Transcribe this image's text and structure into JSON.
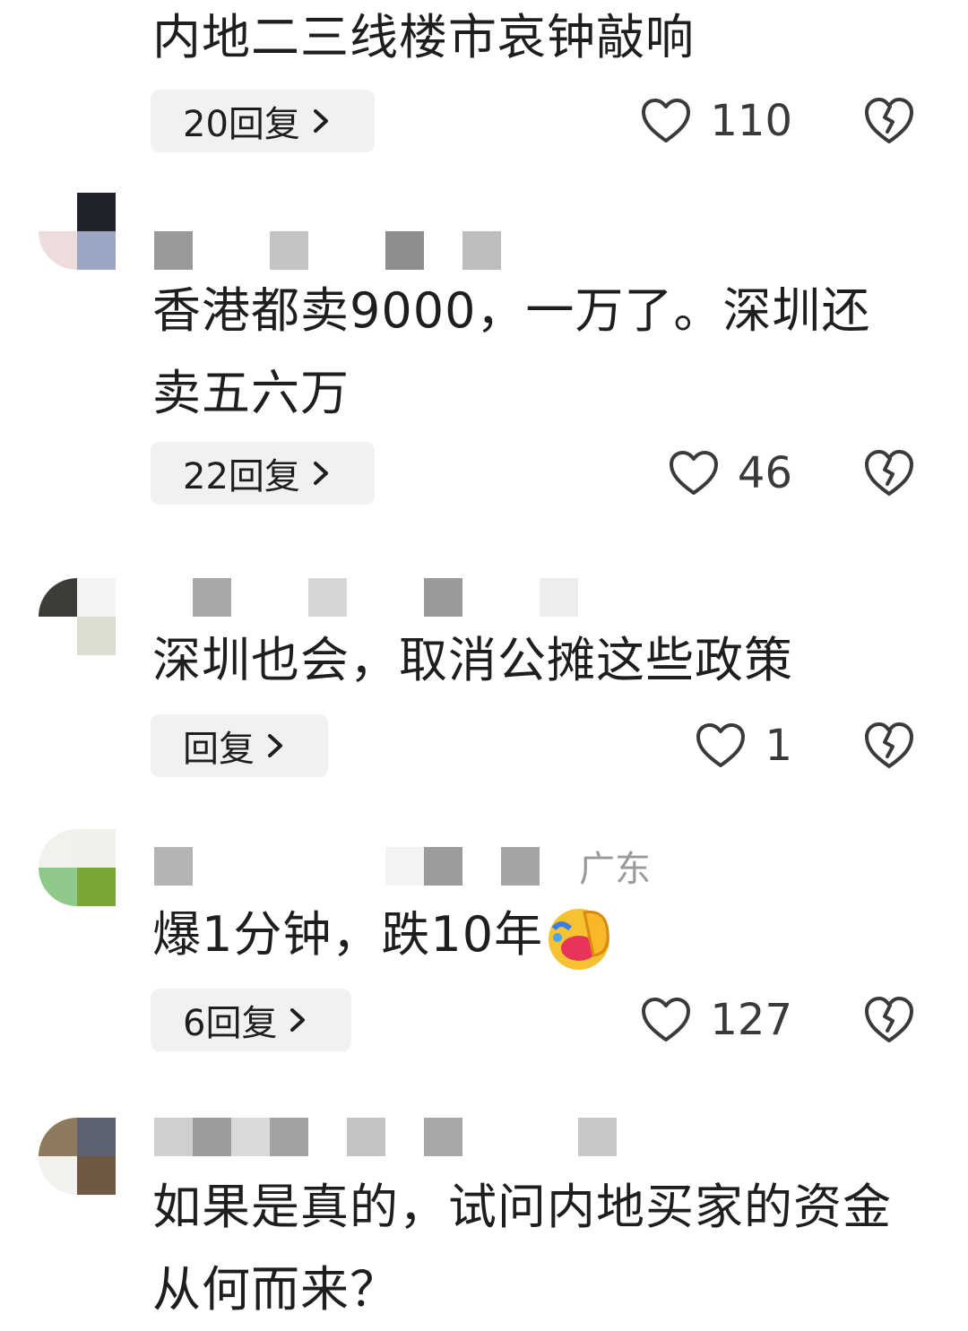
{
  "comments": [
    {
      "text": "内地二三线楼市哀钟敲响",
      "reply_label": "20回复",
      "likes": "110"
    },
    {
      "text": "香港都卖9000，一万了。深圳还卖五六万",
      "reply_label": "22回复",
      "likes": "46"
    },
    {
      "text": "深圳也会，取消公摊这些政策",
      "reply_label": "回复",
      "likes": "1"
    },
    {
      "username_visible": "广东",
      "text": "爆1分钟，跌10年",
      "reply_label": "6回复",
      "likes": "127"
    },
    {
      "text": "如果是真的，试问内地买家的资金从何而来？"
    }
  ],
  "icons": {
    "like": "heart-outline-icon",
    "dislike": "broken-heart-icon",
    "chevron": "chevron-right-icon",
    "emoji": "facepalm-laugh-emoji"
  },
  "colors": {
    "text": "#1e1e1e",
    "reply_bg": "#f1f1f1",
    "icon": "#3a3a3a"
  }
}
